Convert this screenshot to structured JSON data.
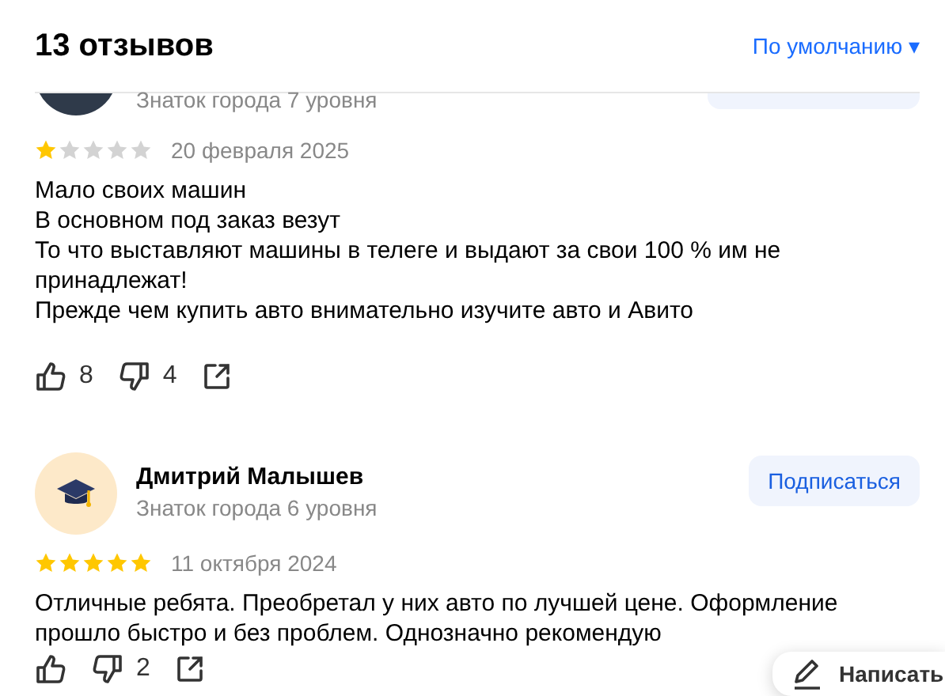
{
  "header": {
    "title": "13 отзывов",
    "sort": "По умолчанию ▾"
  },
  "reviews": [
    {
      "level": "Знаток города 7 уровня",
      "stars": 1,
      "date": "20 февраля 2025",
      "text": [
        "Мало своих машин",
        "В основном под заказ везут",
        "То что выставляют машины в телеге и выдают за свои 100 % им не принадлежат!",
        "Прежде чем купить авто внимательно изучите авто и Авито"
      ],
      "likes": "8",
      "dislikes": "4"
    },
    {
      "author": "Дмитрий Малышев",
      "level": "Знаток города 6 уровня",
      "subscribe": "Подписаться",
      "stars": 5,
      "date": "11 октября 2024",
      "text": [
        "Отличные ребята. Преобретал у них авто по лучшей цене. Оформление прошло быстро и без проблем. Однозначно рекомендую"
      ],
      "dislikes": "2"
    }
  ],
  "write_button": "Написать"
}
